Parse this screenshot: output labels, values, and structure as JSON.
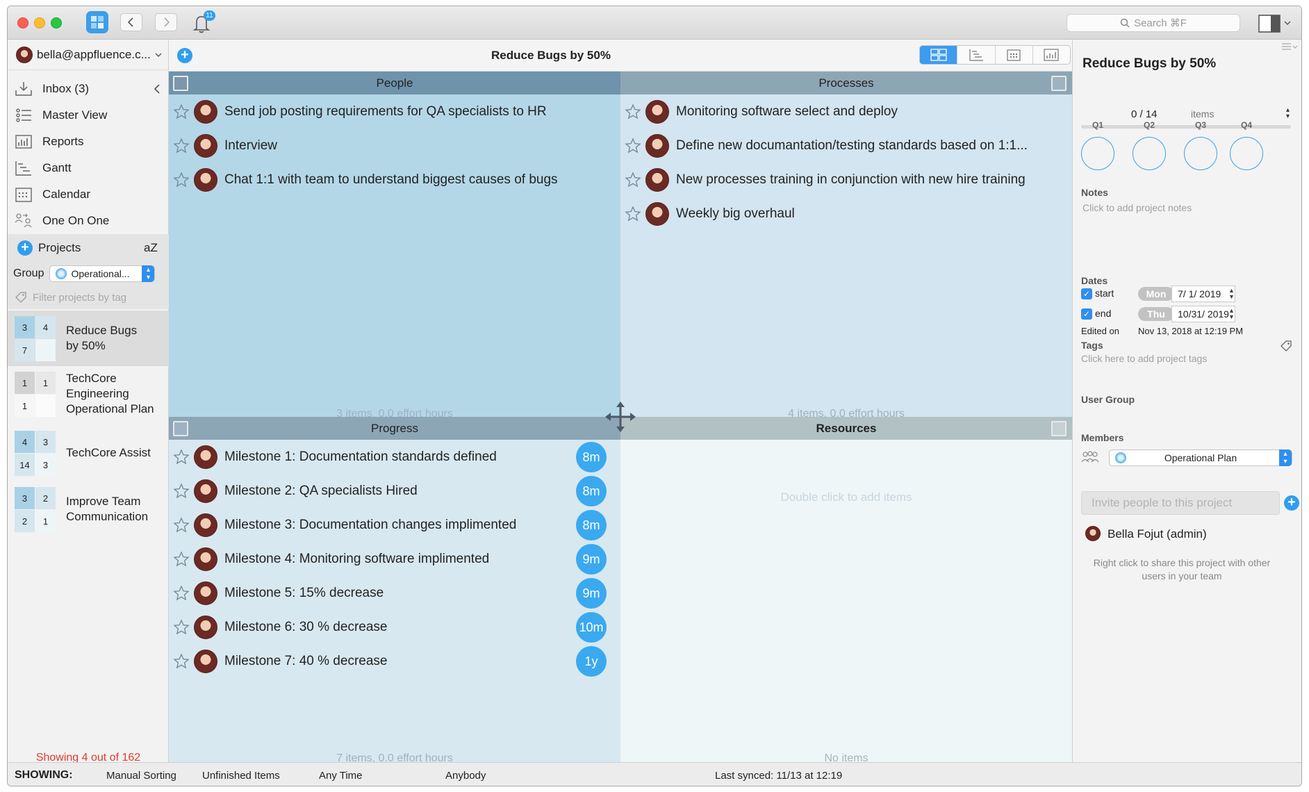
{
  "titlebar": {
    "notifications_count": "11",
    "search_placeholder": "Search ⌘F",
    "icons": [
      "app-icon",
      "back-icon",
      "forward-icon",
      "bell-icon",
      "sidebar-toggle-icon"
    ]
  },
  "sidebar": {
    "account": "bella@appfluence.c...",
    "nav": [
      {
        "label": "Inbox (3)",
        "icon": "inbox-icon"
      },
      {
        "label": "Master View",
        "icon": "list-icon"
      },
      {
        "label": "Reports",
        "icon": "reports-icon"
      },
      {
        "label": "Gantt",
        "icon": "gantt-icon"
      },
      {
        "label": "Calendar",
        "icon": "calendar-icon"
      },
      {
        "label": "One On One",
        "icon": "one-on-one-icon"
      }
    ],
    "projects_label": "Projects",
    "sort_glyph": "aZ",
    "group_label": "Group",
    "group_value": "Operational...",
    "filter_placeholder": "Filter projects by tag",
    "projects": [
      {
        "label": "Reduce Bugs by 50%",
        "counts": [
          "3",
          "4",
          "7",
          ""
        ]
      },
      {
        "label": "TechCore Engineering Operational Plan",
        "counts": [
          "1",
          "1",
          "1",
          ""
        ]
      },
      {
        "label": "TechCore Assist",
        "counts": [
          "4",
          "3",
          "14",
          "3"
        ]
      },
      {
        "label": "Improve Team Communication",
        "counts": [
          "3",
          "2",
          "2",
          "1"
        ]
      }
    ],
    "showing_count": "Showing 4 out of 162"
  },
  "main": {
    "project_title": "Reduce Bugs by 50%",
    "view_tabs": [
      "matrix-view-icon",
      "list-view-icon",
      "calendar-view-icon",
      "report-view-icon"
    ],
    "quadrants": {
      "q1": {
        "title": "People",
        "footer": "3 items, 0.0 effort hours",
        "items": [
          "Send job posting requirements for QA specialists to HR",
          "Interview",
          "Chat 1:1 with team to understand biggest causes of bugs"
        ]
      },
      "q2": {
        "title": "Processes",
        "footer": "4 items, 0.0 effort hours",
        "items": [
          "Monitoring software select and deploy",
          "Define new documantation/testing standards based on 1:1...",
          "New processes training in conjunction with new hire training",
          "Weekly big overhaul"
        ]
      },
      "q3": {
        "title": "Progress",
        "footer": "7 items, 0.0 effort hours",
        "items": [
          {
            "text": "Milestone 1: Documentation standards defined",
            "effort": "8m"
          },
          {
            "text": "Milestone 2: QA specialists Hired",
            "effort": "8m"
          },
          {
            "text": "Milestone 3: Documentation changes implimented",
            "effort": "8m"
          },
          {
            "text": "Milestone 4: Monitoring software implimented",
            "effort": "9m"
          },
          {
            "text": "Milestone 5: 15% decrease",
            "effort": "9m"
          },
          {
            "text": "Milestone 6: 30 % decrease",
            "effort": "10m"
          },
          {
            "text": "Milestone 7: 40 % decrease",
            "effort": "1y"
          }
        ]
      },
      "q4": {
        "title": "Resources",
        "empty_hint": "Double click to add items",
        "footer": "No items"
      }
    },
    "colors": {
      "q1_bg": "#b4d7e8",
      "q1_head": "#6f93ab",
      "q2_bg": "#d3e5f0",
      "q2_head": "#8da6b6",
      "q3_bg": "#d8e8f1",
      "q3_head": "#8da6b6",
      "q4_bg": "#eff6f8",
      "q4_head": "#b2c2c4",
      "accent": "#2f9ef0"
    }
  },
  "inspector": {
    "title": "Reduce Bugs by 50%",
    "progress": "0 / 14",
    "items_select": "items",
    "quarters": [
      "Q1",
      "Q2",
      "Q3",
      "Q4"
    ],
    "notes_label": "Notes",
    "notes_placeholder": "Click to add project notes",
    "dates_label": "Dates",
    "start_label": "start",
    "start_day": "Mon",
    "start_date": "7/  1/ 2019",
    "end_label": "end",
    "end_day": "Thu",
    "end_date": "10/31/ 2019",
    "edited_label": "Edited on",
    "edited_value": "Nov 13, 2018 at 12:19 PM",
    "tags_label": "Tags",
    "tags_placeholder": "Click here to add project tags",
    "user_group_label": "User Group",
    "user_group_value": "Operational Plan",
    "members_label": "Members",
    "invite_placeholder": "Invite people to this project",
    "member_name": "Bella Fojut (admin)",
    "share_hint": "Right click to share this project with other users in your team"
  },
  "statusbar": {
    "showing_label": "SHOWING:",
    "sorting": "Manual Sorting",
    "items_filter": "Unfinished Items",
    "time_filter": "Any Time",
    "person_filter": "Anybody",
    "last_synced": "Last synced: 11/13 at 12:19"
  }
}
